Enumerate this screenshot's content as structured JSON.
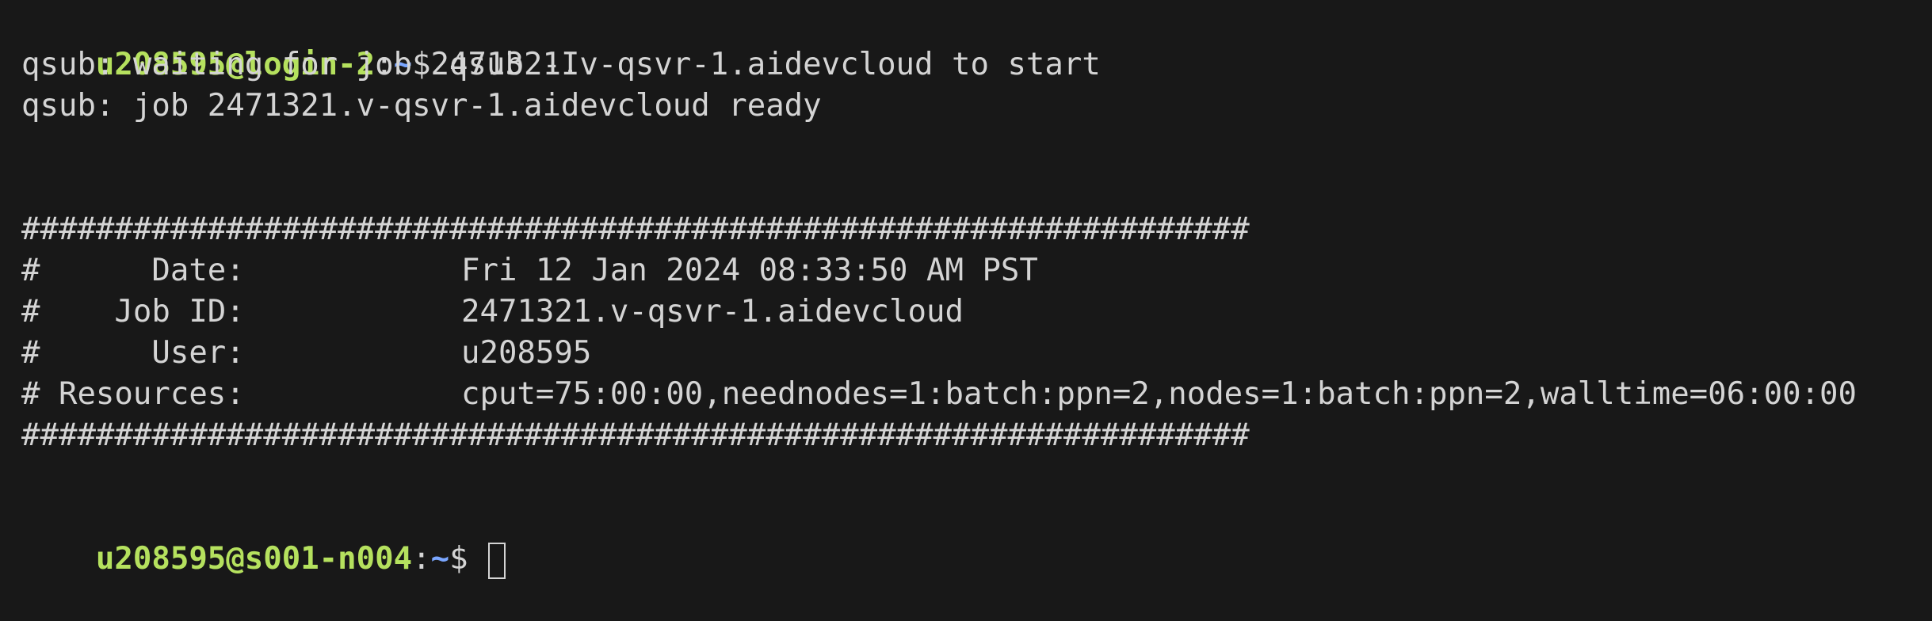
{
  "prompt1": {
    "user_host": "u208595@login-2",
    "colon": ":",
    "path": "~",
    "dollar": "$",
    "command": " qsub -I"
  },
  "output": [
    "qsub: waiting for job 2471321.v-qsvr-1.aidevcloud to start",
    "qsub: job 2471321.v-qsvr-1.aidevcloud ready"
  ],
  "banner": {
    "border": "##################################################################",
    "rows": [
      {
        "label": "#      Date:",
        "value": "Fri 12 Jan 2024 08:33:50 AM PST"
      },
      {
        "label": "#    Job ID:",
        "value": "2471321.v-qsvr-1.aidevcloud"
      },
      {
        "label": "#      User:",
        "value": "u208595"
      },
      {
        "label": "# Resources:",
        "value": "cput=75:00:00,neednodes=1:batch:ppn=2,nodes=1:batch:ppn=2,walltime=06:00:00"
      }
    ]
  },
  "prompt2": {
    "user_host": "u208595@s001-n004",
    "colon": ":",
    "path": "~",
    "dollar": "$ "
  },
  "colors": {
    "background": "#181818",
    "text": "#d4d4d4",
    "user_host": "#b5e15e",
    "path": "#7aa6ff"
  }
}
